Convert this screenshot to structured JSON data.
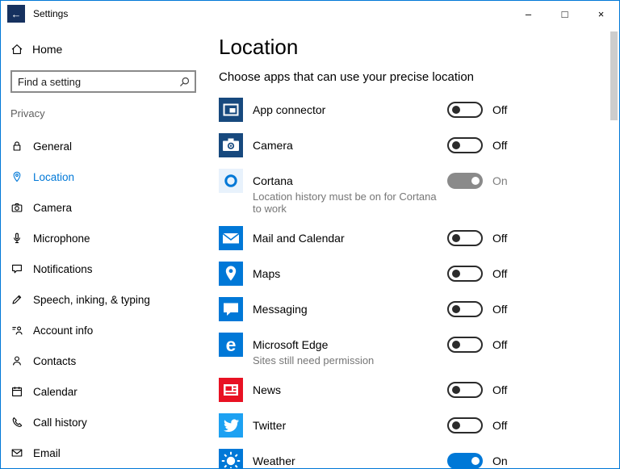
{
  "colors": {
    "accent": "#0078d7",
    "window_border": "#0078d7",
    "news_red": "#e81123",
    "twitter_blue": "#1da1f2",
    "dark_tile_blue": "#17497e",
    "disabled_toggle_gray": "#8a8a8a"
  },
  "window": {
    "title": "Settings",
    "back_glyph": "←",
    "minimize_glyph": "–",
    "maximize_glyph": "□",
    "close_glyph": "×"
  },
  "sidebar": {
    "home_label": "Home",
    "search_placeholder": "Find a setting",
    "section_label": "Privacy",
    "items": [
      {
        "label": "General"
      },
      {
        "label": "Location",
        "selected": true
      },
      {
        "label": "Camera"
      },
      {
        "label": "Microphone"
      },
      {
        "label": "Notifications"
      },
      {
        "label": "Speech, inking, & typing"
      },
      {
        "label": "Account info"
      },
      {
        "label": "Contacts"
      },
      {
        "label": "Calendar"
      },
      {
        "label": "Call history"
      },
      {
        "label": "Email"
      }
    ]
  },
  "main": {
    "title": "Location",
    "subtitle": "Choose apps that can use your precise location",
    "apps": [
      {
        "name": "App connector",
        "state": "Off",
        "tile_color": "#17497e",
        "toggle_class": "toggle off",
        "state_class": "toggle-label"
      },
      {
        "name": "Camera",
        "state": "Off",
        "tile_color": "#17497e",
        "toggle_class": "toggle off",
        "state_class": "toggle-label"
      },
      {
        "name": "Cortana",
        "subtitle": "Location history must be on for Cortana to work",
        "state": "On",
        "tile_color": "#e8f2fc",
        "toggle_class": "toggle on disabled",
        "state_class": "toggle-label dim"
      },
      {
        "name": "Mail and Calendar",
        "state": "Off",
        "tile_color": "#0078d7",
        "toggle_class": "toggle off",
        "state_class": "toggle-label"
      },
      {
        "name": "Maps",
        "state": "Off",
        "tile_color": "#0078d7",
        "toggle_class": "toggle off",
        "state_class": "toggle-label"
      },
      {
        "name": "Messaging",
        "state": "Off",
        "tile_color": "#0078d7",
        "toggle_class": "toggle off",
        "state_class": "toggle-label"
      },
      {
        "name": "Microsoft Edge",
        "subtitle": "Sites still need permission",
        "state": "Off",
        "tile_color": "#0078d7",
        "tile_glyph": "e",
        "toggle_class": "toggle off",
        "state_class": "toggle-label"
      },
      {
        "name": "News",
        "state": "Off",
        "tile_color": "#e81123",
        "toggle_class": "toggle off",
        "state_class": "toggle-label"
      },
      {
        "name": "Twitter",
        "state": "Off",
        "tile_color": "#1da1f2",
        "toggle_class": "toggle off",
        "state_class": "toggle-label"
      },
      {
        "name": "Weather",
        "state": "On",
        "tile_color": "#0078d7",
        "toggle_class": "toggle on",
        "state_class": "toggle-label"
      }
    ]
  }
}
